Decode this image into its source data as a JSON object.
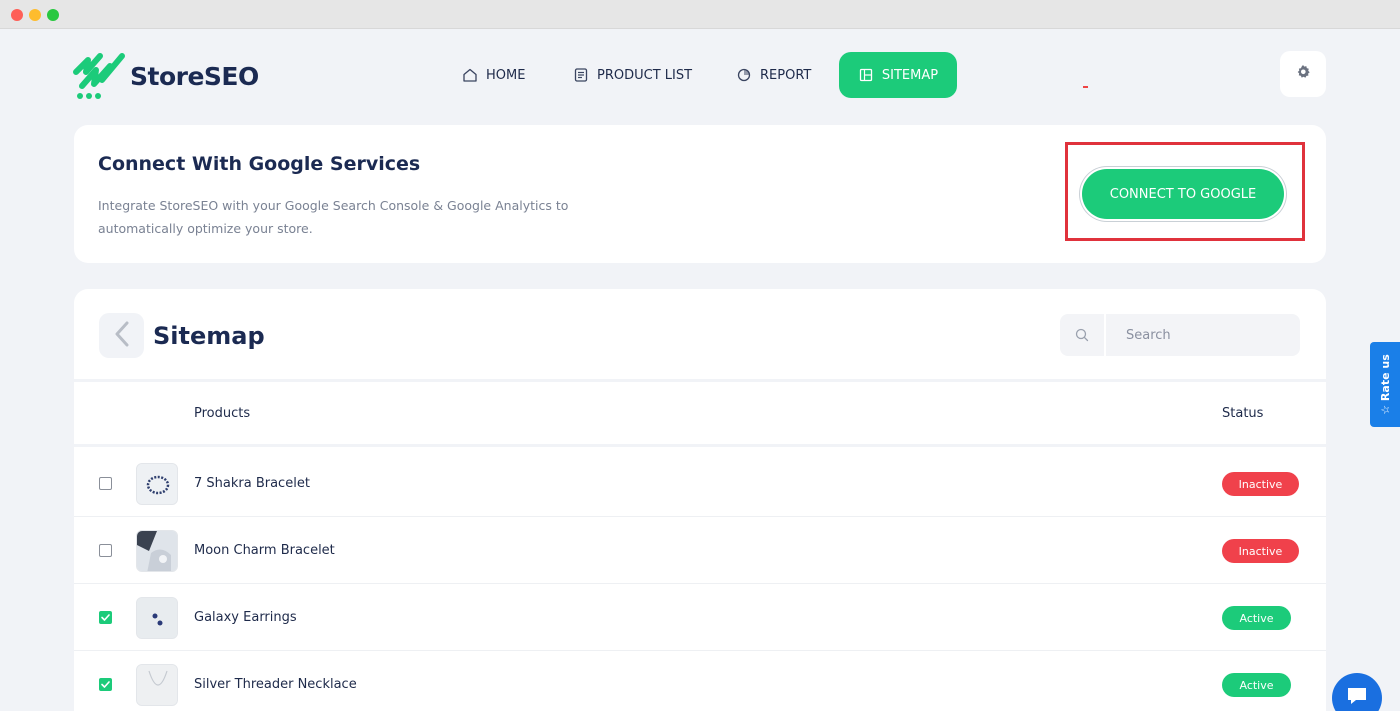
{
  "window": {
    "controls": [
      "close",
      "minimize",
      "maximize"
    ]
  },
  "brand": {
    "name": "StoreSEO",
    "accent": "#1ccb7a"
  },
  "nav": {
    "items": [
      {
        "label": "HOME",
        "icon": "home-icon"
      },
      {
        "label": "PRODUCT LIST",
        "icon": "list-icon"
      },
      {
        "label": "REPORT",
        "icon": "report-icon"
      },
      {
        "label": "SITEMAP",
        "icon": "sitemap-icon",
        "active": true
      }
    ],
    "settings_icon": "gear-icon"
  },
  "connect": {
    "title": "Connect With Google Services",
    "description": "Integrate StoreSEO with your Google Search Console & Google Analytics to automatically optimize your store.",
    "button_label": "CONNECT TO GOOGLE"
  },
  "sitemap": {
    "title": "Sitemap",
    "search_placeholder": "Search",
    "columns": {
      "products": "Products",
      "status": "Status"
    },
    "rows": [
      {
        "name": "7 Shakra Bracelet",
        "status": "Inactive",
        "checked": false
      },
      {
        "name": "Moon Charm Bracelet",
        "status": "Inactive",
        "checked": false
      },
      {
        "name": "Galaxy Earrings",
        "status": "Active",
        "checked": true
      },
      {
        "name": "Silver Threader Necklace",
        "status": "Active",
        "checked": true
      }
    ]
  },
  "rate_tab": {
    "label": "Rate us"
  },
  "colors": {
    "active": "#1ccb7a",
    "inactive": "#f0414b",
    "highlight": "#e0323c",
    "rate_tab": "#1a7fe8"
  }
}
